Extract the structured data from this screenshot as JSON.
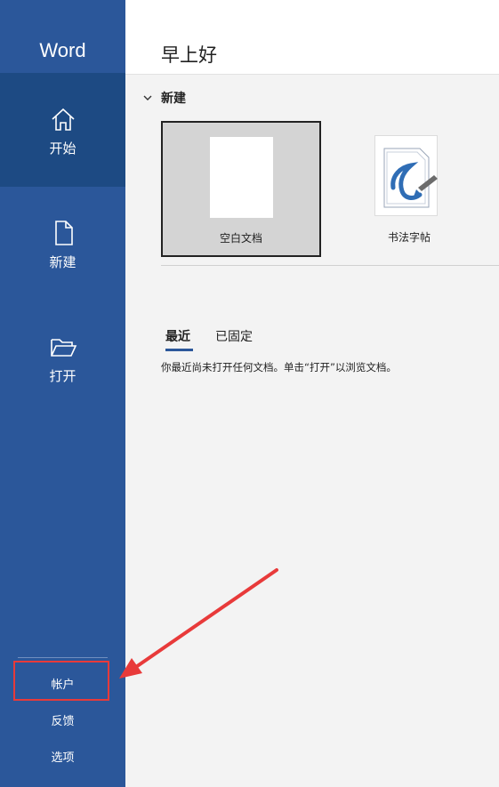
{
  "app": {
    "title": "Word"
  },
  "sidebar": {
    "nav": [
      {
        "label": "开始",
        "icon": "home-icon",
        "active": true
      },
      {
        "label": "新建",
        "icon": "new-document-icon",
        "active": false
      },
      {
        "label": "打开",
        "icon": "folder-open-icon",
        "active": false
      }
    ],
    "bottom": {
      "account": "帐户",
      "feedback": "反馈",
      "options": "选项"
    }
  },
  "main": {
    "greeting": "早上好",
    "new_section": {
      "title": "新建",
      "templates": [
        {
          "label": "空白文档",
          "selected": true
        },
        {
          "label": "书法字帖",
          "selected": false
        }
      ]
    },
    "tabs": [
      {
        "label": "最近",
        "active": true
      },
      {
        "label": "已固定",
        "active": false
      }
    ],
    "empty_message": "你最近尚未打开任何文档。单击“打开”以浏览文档。"
  },
  "colors": {
    "sidebar": "#2b579a",
    "sidebar_active": "#1d4a83",
    "highlight": "#e83a3a"
  }
}
